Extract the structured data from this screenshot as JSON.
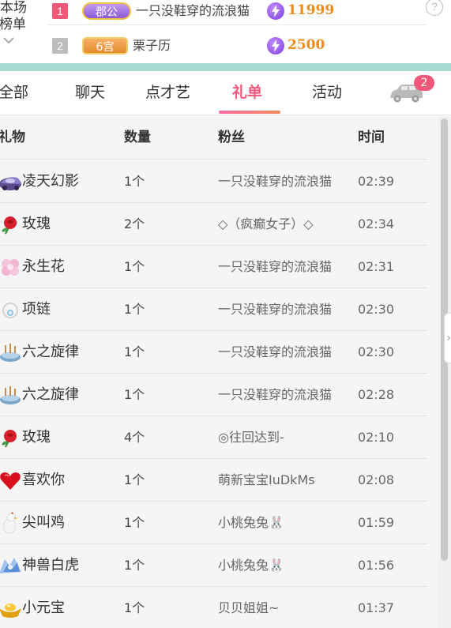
{
  "ranking": {
    "label_line1": "本场",
    "label_line2": "榜单",
    "help": "?",
    "entries": [
      {
        "rank": "1",
        "badge": "郡公",
        "name": "一只没鞋穿的流浪猫",
        "score": "11999"
      },
      {
        "rank": "2",
        "badge": "6宫",
        "name": "栗子历",
        "score": "2500"
      }
    ]
  },
  "tabs": {
    "items": [
      {
        "label": "全部"
      },
      {
        "label": "聊天"
      },
      {
        "label": "点才艺"
      },
      {
        "label": "礼单",
        "active": true
      },
      {
        "label": "活动"
      }
    ],
    "car_badge": "2"
  },
  "table": {
    "headers": {
      "gift": "礼物",
      "qty": "数量",
      "fan": "粉丝",
      "time": "时间"
    },
    "rows": [
      {
        "icon": "phantom-car-icon",
        "gift": "凌天幻影",
        "qty": "1个",
        "fan": "一只没鞋穿的流浪猫",
        "time": "02:39"
      },
      {
        "icon": "rose-icon",
        "gift": "玫瑰",
        "qty": "2个",
        "fan": "◇（疯癫女子）◇",
        "time": "02:34"
      },
      {
        "icon": "eternal-flower-icon",
        "gift": "永生花",
        "qty": "1个",
        "fan": "一只没鞋穿的流浪猫",
        "time": "02:31"
      },
      {
        "icon": "necklace-icon",
        "gift": "项链",
        "qty": "1个",
        "fan": "一只没鞋穿的流浪猫",
        "time": "02:30"
      },
      {
        "icon": "music-box-icon",
        "gift": "六之旋律",
        "qty": "1个",
        "fan": "一只没鞋穿的流浪猫",
        "time": "02:30"
      },
      {
        "icon": "music-box-icon",
        "gift": "六之旋律",
        "qty": "1个",
        "fan": "一只没鞋穿的流浪猫",
        "time": "02:28"
      },
      {
        "icon": "rose-icon",
        "gift": "玫瑰",
        "qty": "4个",
        "fan": "◎往回达到-",
        "time": "02:10"
      },
      {
        "icon": "love-heart-icon",
        "gift": "喜欢你",
        "qty": "1个",
        "fan": "萌新宝宝IuDkMs",
        "time": "02:08"
      },
      {
        "icon": "screaming-chicken-icon",
        "gift": "尖叫鸡",
        "qty": "1个",
        "fan": "小桃兔兔🐰",
        "time": "01:59"
      },
      {
        "icon": "white-tiger-icon",
        "gift": "神兽白虎",
        "qty": "1个",
        "fan": "小桃兔兔🐰",
        "time": "01:56"
      },
      {
        "icon": "gold-ingot-icon",
        "gift": "小元宝",
        "qty": "1个",
        "fan": "贝贝姐姐~",
        "time": "01:37"
      }
    ]
  },
  "colors": {
    "accent_pink": "#f0587a",
    "score_orange": "#f08a18",
    "teal_band": "#a6d9d0"
  }
}
